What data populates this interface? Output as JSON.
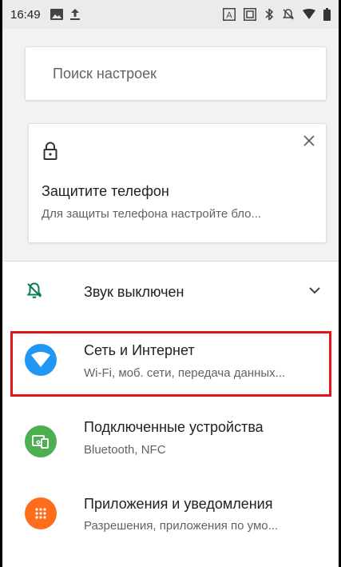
{
  "status_bar": {
    "time": "16:49"
  },
  "search": {
    "placeholder": "Поиск настроек"
  },
  "suggestion": {
    "title": "Защитите телефон",
    "subtitle": "Для защиты телефона настройте бло..."
  },
  "sound": {
    "label": "Звук выключен"
  },
  "settings": [
    {
      "title": "Сеть и Интернет",
      "subtitle": "Wi-Fi, моб. сети, передача данных...",
      "icon": "wifi-icon",
      "color": "#2196f3"
    },
    {
      "title": "Подключенные устройства",
      "subtitle": "Bluetooth, NFC",
      "icon": "devices-icon",
      "color": "#4caf50"
    },
    {
      "title": "Приложения и уведомления",
      "subtitle": "Разрешения, приложения по умо...",
      "icon": "apps-icon",
      "color": "#ff6d1b"
    }
  ],
  "colors": {
    "highlight": "#e3151a",
    "sound_icon": "#0b7a5a"
  }
}
